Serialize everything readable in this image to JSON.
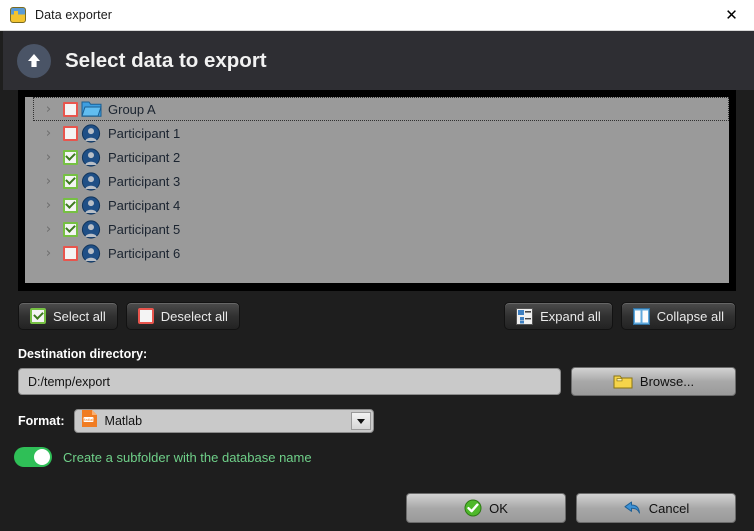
{
  "window": {
    "title": "Data exporter",
    "app_icon": "app-icon",
    "close_icon": "close-icon",
    "close_glyph": "✕"
  },
  "header": {
    "title": "Select data to export",
    "icon": "upload-arrow-icon"
  },
  "tree": {
    "rows": [
      {
        "label": "Group A",
        "checked": false,
        "icon": "folder-icon",
        "expander": "›",
        "focused": true
      },
      {
        "label": "Participant 1",
        "checked": false,
        "icon": "avatar-icon",
        "expander": "›",
        "focused": false
      },
      {
        "label": "Participant 2",
        "checked": true,
        "icon": "avatar-icon",
        "expander": "›",
        "focused": false
      },
      {
        "label": "Participant 3",
        "checked": true,
        "icon": "avatar-icon",
        "expander": "›",
        "focused": false
      },
      {
        "label": "Participant 4",
        "checked": true,
        "icon": "avatar-icon",
        "expander": "›",
        "focused": false
      },
      {
        "label": "Participant 5",
        "checked": true,
        "icon": "avatar-icon",
        "expander": "›",
        "focused": false
      },
      {
        "label": "Participant 6",
        "checked": false,
        "icon": "avatar-icon",
        "expander": "›",
        "focused": false
      }
    ]
  },
  "toolbar": {
    "select_all": "Select all",
    "deselect_all": "Deselect all",
    "expand_all": "Expand all",
    "collapse_all": "Collapse all"
  },
  "destination": {
    "label": "Destination directory:",
    "value": "D:/temp/export",
    "placeholder": "D:/temp/export",
    "browse_label": "Browse...",
    "browse_icon": "folder-icon"
  },
  "format": {
    "label": "Format:",
    "selected": "Matlab",
    "icon": "matlab-file-icon",
    "icon_text": "Matlab",
    "options": [
      "Matlab"
    ]
  },
  "subfolder": {
    "label": "Create a subfolder with the database name",
    "state": "on"
  },
  "footer": {
    "ok_label": "OK",
    "cancel_label": "Cancel"
  },
  "colors": {
    "background": "#1e1e1e",
    "header_bg": "#2e2e33",
    "tree_bg": "#9a9a9a",
    "checked": "#76c043",
    "unchecked": "#e8554d",
    "toggle_on": "#2fbf57",
    "toggle_label": "#6fd089",
    "accent_folder": "#f2c430",
    "matlab_orange": "#f07c22"
  }
}
